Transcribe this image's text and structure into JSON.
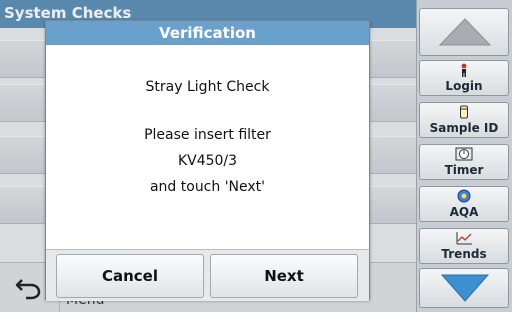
{
  "background": {
    "header_title": "System Checks",
    "menu_label": "Menu"
  },
  "sidebar": {
    "up_icon": "triangle-up-icon",
    "down_icon": "triangle-down-icon",
    "items": [
      {
        "label": "Login",
        "icon": "person-icon"
      },
      {
        "label": "Sample ID",
        "icon": "sample-id-icon"
      },
      {
        "label": "Timer",
        "icon": "timer-icon"
      },
      {
        "label": "AQA",
        "icon": "aqa-icon"
      },
      {
        "label": "Trends",
        "icon": "trends-icon"
      }
    ]
  },
  "dialog": {
    "title": "Verification",
    "heading": "Stray Light Check",
    "line1": "Please insert filter",
    "line2": "KV450/3",
    "line3": "and touch 'Next'",
    "cancel_label": "Cancel",
    "next_label": "Next"
  },
  "colors": {
    "header_blue": "#5b8fb6",
    "dialog_title_blue": "#6aa0cc",
    "nav_triangle": "#3c8fd0"
  }
}
